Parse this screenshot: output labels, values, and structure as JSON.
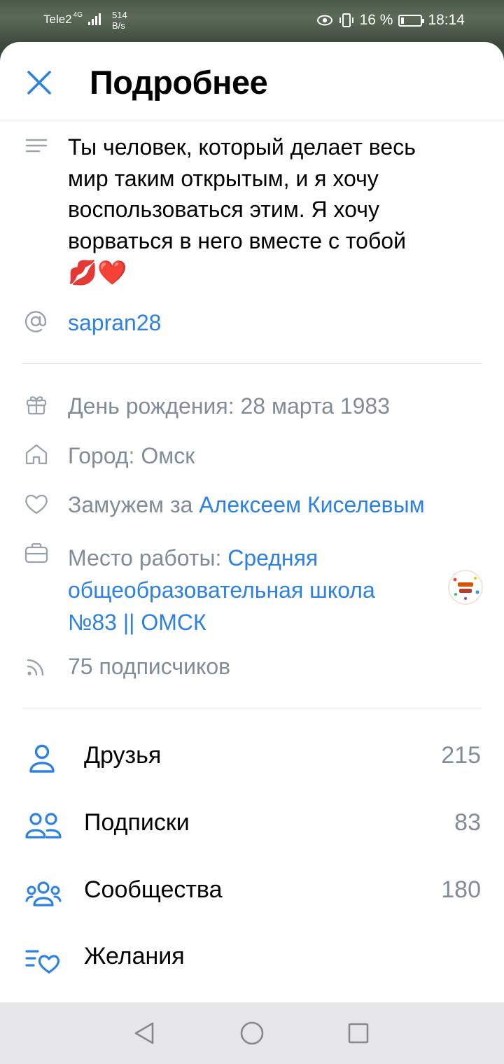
{
  "statusbar": {
    "carrier": "Tele2",
    "network": "4G",
    "speed_value": "514",
    "speed_unit": "B/s",
    "battery": "16 %",
    "battery_level": 0.16,
    "time": "18:14"
  },
  "header": {
    "title": "Подробнее",
    "close_icon": "close-icon"
  },
  "profile": {
    "status_lines": [
      "Ты человек, который делает весь",
      "мир таким открытым, и я хочу",
      "воспользоваться этим. Я  хочу",
      "ворваться в него вместе с тобой"
    ],
    "status_emoji": "💋❤️",
    "nickname": "sapran28",
    "birthday": "День рождения: 28 марта 1983",
    "city": "Город: Омск",
    "relationship_prefix": "Замужем за ",
    "relationship_partner": "Алексеем Киселевым",
    "work_prefix": "Место работы: ",
    "work_line1": "Средняя",
    "work_line2": "общеобразовательная школа",
    "work_line3": "№83 || ОМСК",
    "followers": "75 подписчиков"
  },
  "menu": [
    {
      "label": "Друзья",
      "count": "215",
      "icon": "user-icon"
    },
    {
      "label": "Подписки",
      "count": "83",
      "icon": "users-icon"
    },
    {
      "label": "Сообщества",
      "count": "180",
      "icon": "communities-icon"
    },
    {
      "label": "Желания",
      "count": "",
      "icon": "wishlist-icon"
    }
  ],
  "colors": {
    "accent": "#2d81e0",
    "secondary_text": "#818c99",
    "icon_gray": "#99a2ad"
  }
}
